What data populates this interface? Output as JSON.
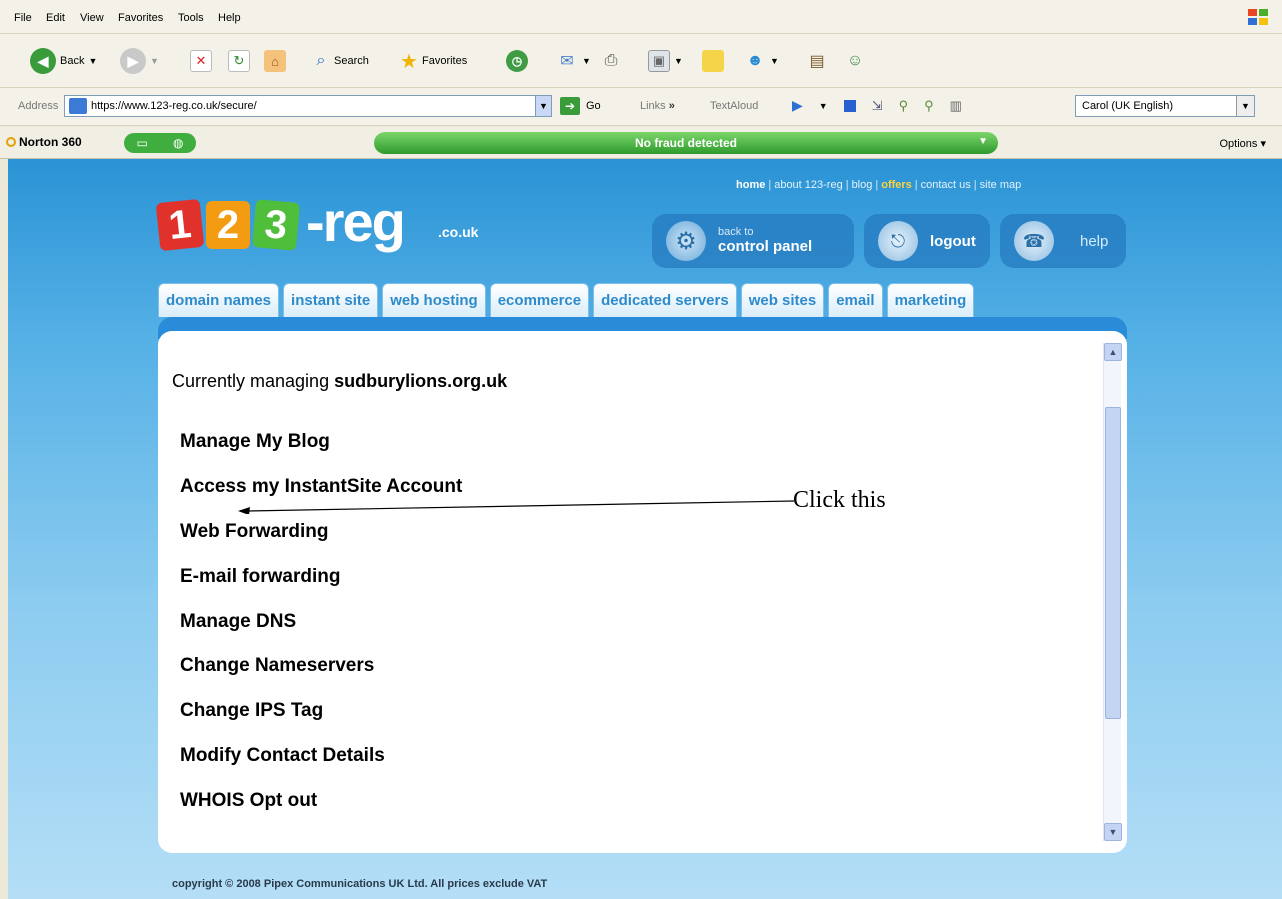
{
  "menubar": {
    "items": [
      "File",
      "Edit",
      "View",
      "Favorites",
      "Tools",
      "Help"
    ]
  },
  "toolbar": {
    "back_label": "Back",
    "search_label": "Search",
    "favorites_label": "Favorites"
  },
  "addressbar": {
    "label": "Address",
    "url": "https://www.123-reg.co.uk/secure/",
    "go_label": "Go",
    "links_label": "Links",
    "textaloud_label": "TextAloud",
    "voice": "Carol (UK English)"
  },
  "norton": {
    "name": "Norton 360",
    "status": "No fraud detected",
    "options_label": "Options"
  },
  "site": {
    "topnav": [
      "home",
      "about 123-reg",
      "blog",
      "offers",
      "contact us",
      "site map"
    ],
    "logo": {
      "digit1": "1",
      "digit2": "2",
      "digit3": "3",
      "suffix": "-reg",
      "tld": ".co.uk"
    },
    "control_panel": {
      "small": "back to",
      "big": "control panel"
    },
    "logout_label": "logout",
    "help_label": "help",
    "tabs": [
      "domain names",
      "instant site",
      "web hosting",
      "ecommerce",
      "dedicated servers",
      "web sites",
      "email",
      "marketing"
    ],
    "managing_prefix": "Currently managing",
    "managing_domain": "sudburylions.org.uk",
    "options": [
      "Manage My Blog",
      "Access my InstantSite Account",
      "Web Forwarding",
      "E-mail forwarding",
      "Manage DNS",
      "Change Nameservers",
      "Change IPS Tag",
      "Modify Contact Details",
      "WHOIS Opt out"
    ],
    "annotation": "Click this",
    "copyright": "copyright © 2008 Pipex Communications UK Ltd. All prices exclude VAT"
  },
  "colors": {
    "accent_blue": "#2a8bd8",
    "tab_text": "#2d8bcb",
    "fraud_green": "#2e9a2e",
    "offers_yellow": "#ffd23a"
  }
}
